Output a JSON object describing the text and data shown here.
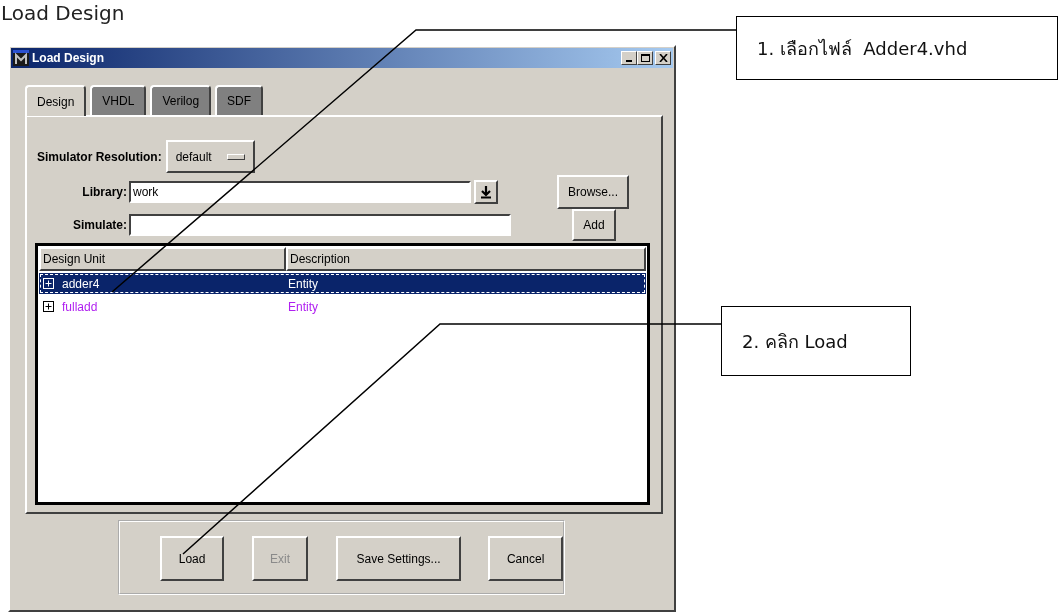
{
  "heading": "Load Design",
  "window": {
    "title": "Load Design"
  },
  "tabs": [
    {
      "label": "Design",
      "selected": true
    },
    {
      "label": "VHDL",
      "selected": false
    },
    {
      "label": "Verilog",
      "selected": false
    },
    {
      "label": "SDF",
      "selected": false
    }
  ],
  "form": {
    "resolution": {
      "label": "Simulator Resolution:",
      "value": "default"
    },
    "library": {
      "label": "Library:",
      "value": "work"
    },
    "browse_button": "Browse...",
    "simulate": {
      "label": "Simulate:"
    },
    "add_button": "Add"
  },
  "table": {
    "columns": [
      "Design Unit",
      "Description"
    ],
    "rows": [
      {
        "cells": [
          "adder4",
          "Entity"
        ],
        "selected": true,
        "expanded": false
      },
      {
        "cells": [
          "fulladd",
          "Entity"
        ],
        "selected": false,
        "expanded": false
      }
    ]
  },
  "buttons": [
    {
      "label": "Load",
      "disabled": false
    },
    {
      "label": "Exit",
      "disabled": true
    },
    {
      "label": "Save Settings...",
      "disabled": false
    },
    {
      "label": "Cancel",
      "disabled": false
    }
  ],
  "callouts": [
    {
      "text": "1. เลือกไฟล์  Adder4.vhd"
    },
    {
      "text": "2. คลิก Load"
    }
  ]
}
